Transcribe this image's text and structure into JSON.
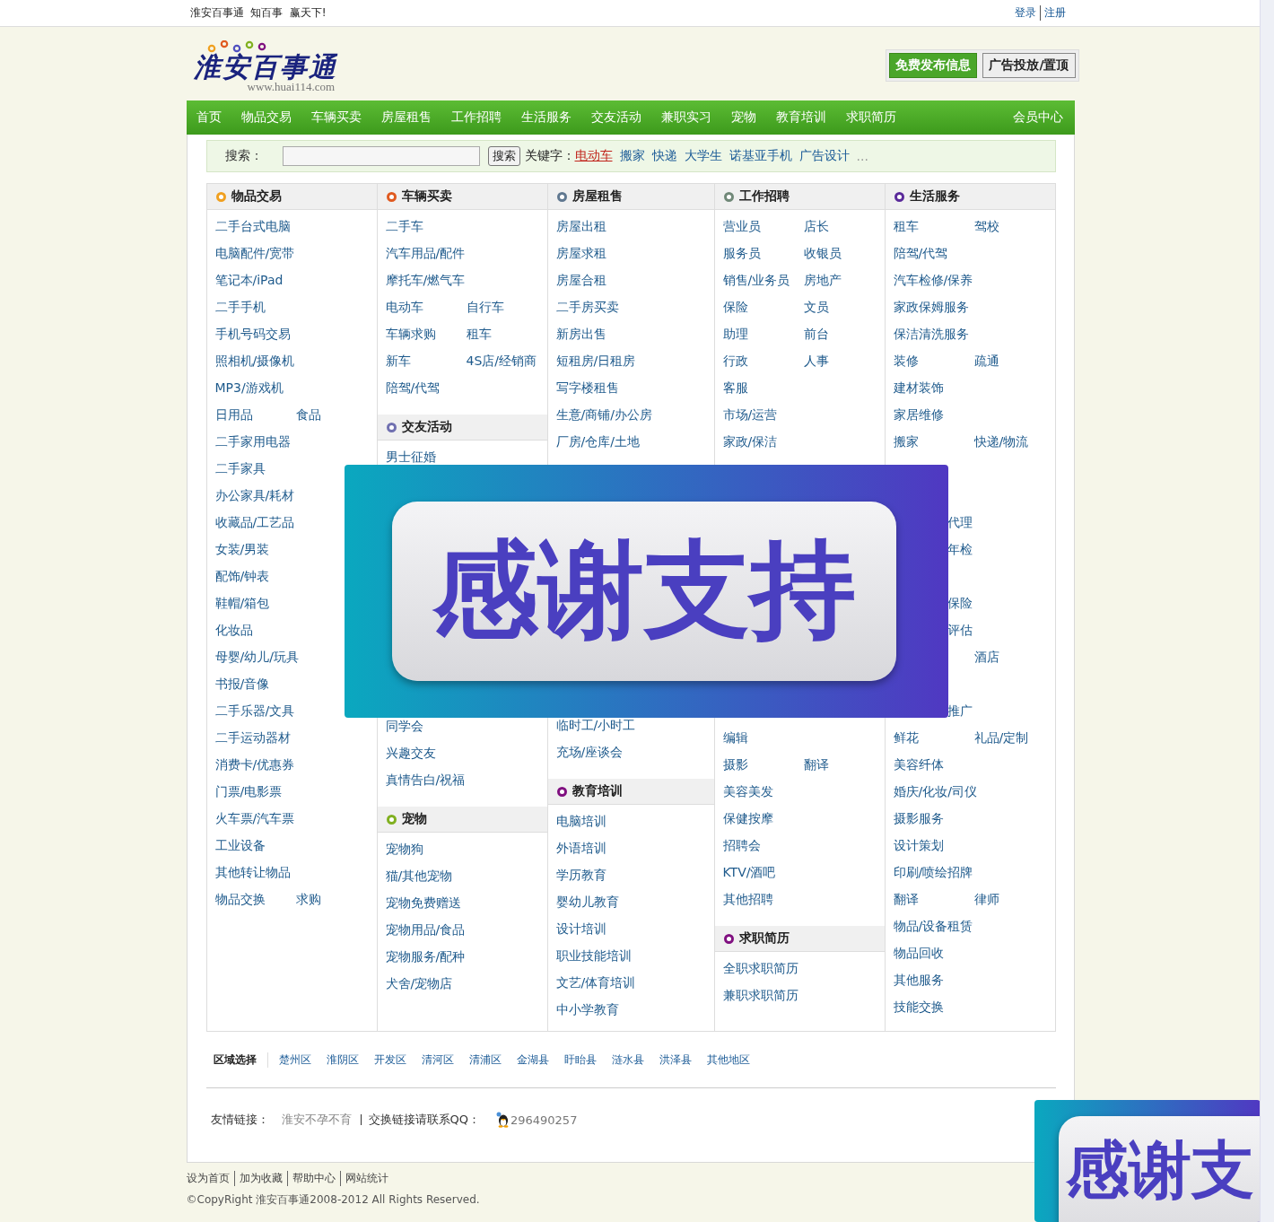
{
  "top_bar": {
    "slogan": "淮安百事通  知百事  赢天下!",
    "links": [
      "登录",
      "注册"
    ]
  },
  "logo": {
    "title": "淮安百事通",
    "url": "www.huai114.com"
  },
  "header_buttons": [
    {
      "label": "免费发布信息",
      "kind": "primary"
    },
    {
      "label": "广告投放/置顶",
      "kind": "secondary"
    }
  ],
  "nav": {
    "items": [
      "首页",
      "物品交易",
      "车辆买卖",
      "房屋租售",
      "工作招聘",
      "生活服务",
      "交友活动",
      "兼职实习",
      "宠物",
      "教育培训",
      "求职简历"
    ],
    "member": "会员中心"
  },
  "search": {
    "label": "搜索：",
    "button": "搜索",
    "keywords_label": "关键字：",
    "keywords": [
      {
        "text": "电动车",
        "hot": true
      },
      {
        "text": "搬家",
        "hot": false
      },
      {
        "text": "快递",
        "hot": false
      },
      {
        "text": "大学生",
        "hot": false
      },
      {
        "text": "诺基亚手机",
        "hot": false
      },
      {
        "text": "广告设计",
        "hot": false
      }
    ],
    "more": "..."
  },
  "columns": [
    {
      "sections": [
        {
          "title": "物品交易",
          "color": "#f0a020",
          "rows": [
            {
              "kind": "links",
              "cells": [
                "二手台式电脑"
              ]
            },
            {
              "kind": "links",
              "cells": [
                "电脑配件/宽带"
              ]
            },
            {
              "kind": "links",
              "cells": [
                "笔记本/iPad"
              ]
            },
            {
              "kind": "links",
              "cells": [
                "二手手机"
              ]
            },
            {
              "kind": "links",
              "cells": [
                "手机号码交易"
              ]
            },
            {
              "kind": "links",
              "cells": [
                "照相机/摄像机"
              ]
            },
            {
              "kind": "links",
              "cells": [
                "MP3/游戏机"
              ]
            },
            {
              "kind": "links",
              "cells": [
                "日用品",
                "食品"
              ]
            },
            {
              "kind": "links",
              "cells": [
                "二手家用电器"
              ]
            },
            {
              "kind": "links",
              "cells": [
                "二手家具"
              ]
            },
            {
              "kind": "links",
              "cells": [
                "办公家具/耗材"
              ]
            },
            {
              "kind": "links",
              "cells": [
                "收藏品/工艺品"
              ]
            },
            {
              "kind": "links",
              "cells": [
                "女装/男装"
              ]
            },
            {
              "kind": "links",
              "cells": [
                "配饰/钟表"
              ]
            },
            {
              "kind": "links",
              "cells": [
                "鞋帽/箱包"
              ]
            },
            {
              "kind": "links",
              "cells": [
                "化妆品"
              ]
            },
            {
              "kind": "links",
              "cells": [
                "母婴/幼儿/玩具"
              ]
            },
            {
              "kind": "links",
              "cells": [
                "书报/音像"
              ]
            },
            {
              "kind": "links",
              "cells": [
                "二手乐器/文具"
              ]
            },
            {
              "kind": "links",
              "cells": [
                "二手运动器材"
              ]
            },
            {
              "kind": "links",
              "cells": [
                "消费卡/优惠券"
              ]
            },
            {
              "kind": "links",
              "cells": [
                "门票/电影票"
              ]
            },
            {
              "kind": "links",
              "cells": [
                "火车票/汽车票"
              ]
            },
            {
              "kind": "links",
              "cells": [
                "工业设备"
              ]
            },
            {
              "kind": "links",
              "cells": [
                "其他转让物品"
              ]
            },
            {
              "kind": "links",
              "cells": [
                "物品交换",
                "求购"
              ]
            }
          ]
        }
      ]
    },
    {
      "sections": [
        {
          "title": "车辆买卖",
          "color": "#e05a20",
          "rows": [
            {
              "kind": "links",
              "cells": [
                "二手车"
              ]
            },
            {
              "kind": "links",
              "cells": [
                "汽车用品/配件"
              ]
            },
            {
              "kind": "links",
              "cells": [
                "摩托车/燃气车"
              ]
            },
            {
              "kind": "links",
              "cells": [
                "电动车",
                "自行车"
              ]
            },
            {
              "kind": "links",
              "cells": [
                "车辆求购",
                "租车"
              ]
            },
            {
              "kind": "links",
              "cells": [
                "新车",
                "4S店/经销商"
              ]
            },
            {
              "kind": "links",
              "cells": [
                "陪驾/代驾"
              ]
            }
          ]
        },
        {
          "title": "交友活动",
          "color": "#7070b0",
          "rows": [
            {
              "kind": "links",
              "cells": [
                "男士征婚"
              ]
            },
            {
              "kind": "covered"
            },
            {
              "kind": "covered"
            },
            {
              "kind": "covered"
            },
            {
              "kind": "covered"
            },
            {
              "kind": "covered"
            },
            {
              "kind": "covered"
            },
            {
              "kind": "covered"
            },
            {
              "kind": "covered"
            },
            {
              "kind": "covered"
            },
            {
              "kind": "links",
              "cells": [
                "同学会"
              ]
            },
            {
              "kind": "links",
              "cells": [
                "兴趣交友"
              ]
            },
            {
              "kind": "links",
              "cells": [
                "真情告白/祝福"
              ]
            }
          ]
        },
        {
          "title": "宠物",
          "color": "#80b020",
          "rows": [
            {
              "kind": "links",
              "cells": [
                "宠物狗"
              ]
            },
            {
              "kind": "links",
              "cells": [
                "猫/其他宠物"
              ]
            },
            {
              "kind": "links",
              "cells": [
                "宠物免费赠送"
              ]
            },
            {
              "kind": "links",
              "cells": [
                "宠物用品/食品"
              ]
            },
            {
              "kind": "links",
              "cells": [
                "宠物服务/配种"
              ]
            },
            {
              "kind": "links",
              "cells": [
                "犬舍/宠物店"
              ]
            }
          ]
        }
      ]
    },
    {
      "sections": [
        {
          "title": "房屋租售",
          "color": "#607890",
          "rows": [
            {
              "kind": "links",
              "cells": [
                "房屋出租"
              ]
            },
            {
              "kind": "links",
              "cells": [
                "房屋求租"
              ]
            },
            {
              "kind": "links",
              "cells": [
                "房屋合租"
              ]
            },
            {
              "kind": "links",
              "cells": [
                "二手房买卖"
              ]
            },
            {
              "kind": "links",
              "cells": [
                "新房出售"
              ]
            },
            {
              "kind": "links",
              "cells": [
                "短租房/日租房"
              ]
            },
            {
              "kind": "links",
              "cells": [
                "写字楼租售"
              ]
            },
            {
              "kind": "links",
              "cells": [
                "生意/商铺/办公房"
              ]
            },
            {
              "kind": "links",
              "cells": [
                "厂房/仓库/土地"
              ]
            }
          ]
        },
        {
          "rows": [
            {
              "kind": "covered"
            },
            {
              "kind": "covered"
            },
            {
              "kind": "covered"
            },
            {
              "kind": "covered"
            },
            {
              "kind": "covered"
            },
            {
              "kind": "covered"
            },
            {
              "kind": "covered"
            },
            {
              "kind": "covered"
            },
            {
              "kind": "links",
              "cells": [
                "临时工/小时工"
              ]
            },
            {
              "kind": "links",
              "cells": [
                "充场/座谈会"
              ]
            }
          ]
        },
        {
          "title": "教育培训",
          "color": "#801080",
          "rows": [
            {
              "kind": "links",
              "cells": [
                "电脑培训"
              ]
            },
            {
              "kind": "links",
              "cells": [
                "外语培训"
              ]
            },
            {
              "kind": "links",
              "cells": [
                "学历教育"
              ]
            },
            {
              "kind": "links",
              "cells": [
                "婴幼儿教育"
              ]
            },
            {
              "kind": "links",
              "cells": [
                "设计培训"
              ]
            },
            {
              "kind": "links",
              "cells": [
                "职业技能培训"
              ]
            },
            {
              "kind": "links",
              "cells": [
                "文艺/体育培训"
              ]
            },
            {
              "kind": "links",
              "cells": [
                "中小学教育"
              ]
            }
          ]
        }
      ]
    },
    {
      "sections": [
        {
          "title": "工作招聘",
          "color": "#708878",
          "rows": [
            {
              "kind": "links",
              "cells": [
                "营业员",
                "店长"
              ]
            },
            {
              "kind": "links",
              "cells": [
                "服务员",
                "收银员"
              ]
            },
            {
              "kind": "links",
              "cells": [
                "销售/业务员",
                "房地产"
              ]
            },
            {
              "kind": "links",
              "cells": [
                "保险",
                "文员"
              ]
            },
            {
              "kind": "links",
              "cells": [
                "助理",
                "前台"
              ]
            },
            {
              "kind": "links",
              "cells": [
                "行政",
                "人事"
              ]
            },
            {
              "kind": "links",
              "cells": [
                "客服"
              ]
            },
            {
              "kind": "links",
              "cells": [
                "市场/运营"
              ]
            },
            {
              "kind": "links",
              "cells": [
                "家政/保洁"
              ]
            },
            {
              "kind": "covered"
            },
            {
              "kind": "covered"
            },
            {
              "kind": "covered"
            },
            {
              "kind": "covered"
            },
            {
              "kind": "covered"
            },
            {
              "kind": "covered"
            },
            {
              "kind": "covered"
            },
            {
              "kind": "covered"
            },
            {
              "kind": "covered"
            },
            {
              "kind": "covered"
            },
            {
              "kind": "links",
              "cells": [
                "编辑"
              ]
            },
            {
              "kind": "links",
              "cells": [
                "摄影",
                "翻译"
              ]
            },
            {
              "kind": "links",
              "cells": [
                "美容美发"
              ]
            },
            {
              "kind": "links",
              "cells": [
                "保健按摩"
              ]
            },
            {
              "kind": "links",
              "cells": [
                "招聘会"
              ]
            },
            {
              "kind": "links",
              "cells": [
                "KTV/酒吧"
              ]
            },
            {
              "kind": "links",
              "cells": [
                "其他招聘"
              ]
            }
          ]
        },
        {
          "title": "求职简历",
          "color": "#801080",
          "rows": [
            {
              "kind": "links",
              "cells": [
                "全职求职简历"
              ]
            },
            {
              "kind": "links",
              "cells": [
                "兼职求职简历"
              ]
            }
          ]
        }
      ]
    },
    {
      "sections": [
        {
          "title": "生活服务",
          "color": "#5a2a9a",
          "rows": [
            {
              "kind": "links",
              "cells": [
                "租车",
                "驾校"
              ]
            },
            {
              "kind": "links",
              "cells": [
                "陪驾/代驾"
              ]
            },
            {
              "kind": "links",
              "cells": [
                "汽车检修/保养"
              ]
            },
            {
              "kind": "links",
              "cells": [
                "家政保姆服务"
              ]
            },
            {
              "kind": "links",
              "cells": [
                "保洁清洗服务"
              ]
            },
            {
              "kind": "links",
              "cells": [
                "装修",
                "疏通"
              ]
            },
            {
              "kind": "links",
              "cells": [
                "建材装饰"
              ]
            },
            {
              "kind": "links",
              "cells": [
                "家居维修"
              ]
            },
            {
              "kind": "links",
              "cells": [
                "搬家",
                "快递/物流"
              ]
            },
            {
              "kind": "covered"
            },
            {
              "kind": "covered"
            },
            {
              "kind": "tail",
              "cells": [
                "代理"
              ]
            },
            {
              "kind": "tail",
              "cells": [
                "年检"
              ]
            },
            {
              "kind": "covered"
            },
            {
              "kind": "tail",
              "cells": [
                "保险"
              ]
            },
            {
              "kind": "tail",
              "cells": [
                "评估"
              ]
            },
            {
              "kind": "second",
              "cells": [
                "酒店"
              ]
            },
            {
              "kind": "covered"
            },
            {
              "kind": "tail",
              "cells": [
                "推广"
              ]
            },
            {
              "kind": "links",
              "cells": [
                "鲜花",
                "礼品/定制"
              ]
            },
            {
              "kind": "links",
              "cells": [
                "美容纤体"
              ]
            },
            {
              "kind": "links",
              "cells": [
                "婚庆/化妆/司仪"
              ]
            },
            {
              "kind": "links",
              "cells": [
                "摄影服务"
              ]
            },
            {
              "kind": "links",
              "cells": [
                "设计策划"
              ]
            },
            {
              "kind": "links",
              "cells": [
                "印刷/喷绘招牌"
              ]
            },
            {
              "kind": "links",
              "cells": [
                "翻译",
                "律师"
              ]
            },
            {
              "kind": "links",
              "cells": [
                "物品/设备租赁"
              ]
            },
            {
              "kind": "links",
              "cells": [
                "物品回收"
              ]
            },
            {
              "kind": "links",
              "cells": [
                "其他服务"
              ]
            },
            {
              "kind": "links",
              "cells": [
                "技能交换"
              ]
            }
          ]
        }
      ]
    }
  ],
  "regions": {
    "label": "区域选择",
    "items": [
      "楚州区",
      "淮阴区",
      "开发区",
      "清河区",
      "清浦区",
      "金湖县",
      "盱眙县",
      "涟水县",
      "洪泽县",
      "其他地区"
    ]
  },
  "friend_links": {
    "label": "友情链接：",
    "links": [
      "淮安不孕不育"
    ],
    "contact": "交换链接请联系QQ：",
    "qq": "296490257"
  },
  "footer": {
    "links": [
      "设为首页",
      "加为收藏",
      "帮助中心",
      "网站统计"
    ],
    "copyright": "©CopyRight 淮安百事通2008-2012 All Rights Reserved."
  },
  "floating_ads": [
    {
      "text": "感谢支持"
    },
    {
      "text": "感谢支"
    }
  ]
}
